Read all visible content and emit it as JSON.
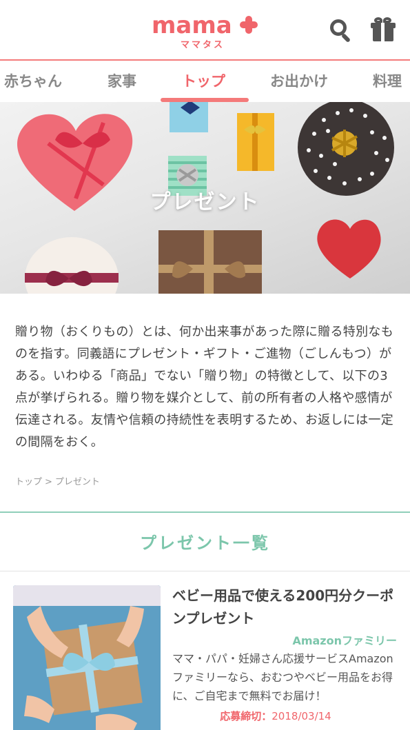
{
  "header": {
    "logo_text": "mama",
    "logo_sub": "ママタス",
    "search_icon": "search-icon",
    "gift_icon": "gift-icon",
    "accent_color": "#f0656b"
  },
  "tabs": [
    {
      "label": "赤ちゃん",
      "active": false
    },
    {
      "label": "家事",
      "active": false
    },
    {
      "label": "トップ",
      "active": true
    },
    {
      "label": "お出かけ",
      "active": false
    },
    {
      "label": "料理",
      "active": false
    }
  ],
  "hero": {
    "title": "プレゼント"
  },
  "description": "贈り物（おくりもの）とは、何か出来事があった際に贈る特別なものを指す。同義語にプレゼント・ギフト・ご進物（ごしんもつ）がある。いわゆる「商品」でない「贈り物」の特徴として、以下の3点が挙げられる。贈り物を媒介として、前の所有者の人格や感情が伝達される。友情や信頼の持続性を表明するため、お返しには一定の間隔をおく。",
  "breadcrumb": {
    "home": "トップ",
    "separator": ">",
    "current": "プレゼント"
  },
  "section": {
    "title": "プレゼント一覧",
    "color": "#7cc6ab"
  },
  "cards": [
    {
      "title": "ベビー用品で使える200円分クーポンプレゼント",
      "source": "Amazonファミリー",
      "description": "ママ・パパ・妊婦さん応援サービスAmazonファミリーなら、おむつやベビー用品をお得に、ご自宅まで無料でお届け！",
      "deadline_label": "応募締切：",
      "deadline_value": "2018/03/14"
    }
  ]
}
